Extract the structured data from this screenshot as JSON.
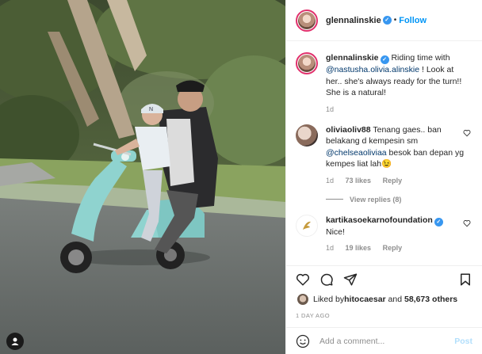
{
  "header": {
    "username": "glennalinskie",
    "dot": "•",
    "follow_label": "Follow"
  },
  "caption": {
    "username": "glennalinskie",
    "text_a": "Riding time with ",
    "mention": "@nastusha.olivia.alinskie",
    "text_b": " ! Look at her.. she's always ready for the turn!! She is a natural!",
    "time": "1d"
  },
  "comments": [
    {
      "username": "oliviaoliv88",
      "text_a": "Tenang gaes.. ban belakang d kempesin sm ",
      "mention": "@chelseaoliviaa",
      "text_b": " besok ban depan yg kempes liat lah😉",
      "time": "1d",
      "likes": "73 likes",
      "reply": "Reply",
      "view_replies": "View replies (8)"
    },
    {
      "username": "kartikasoekarnofoundation",
      "text": "Nice!",
      "time": "1d",
      "likes": "19 likes",
      "reply": "Reply"
    }
  ],
  "likes": {
    "prefix": "Liked by ",
    "user": "hitocaesar",
    "middle": " and ",
    "count": "58,673 others"
  },
  "time_ago": "1 DAY AGO",
  "comment_box": {
    "placeholder": "Add a comment...",
    "post_label": "Post"
  },
  "colors": {
    "follow": "#0095f6",
    "verified": "#3897f0",
    "muted": "#8e8e8e",
    "vespa": "#8fd3cf"
  }
}
